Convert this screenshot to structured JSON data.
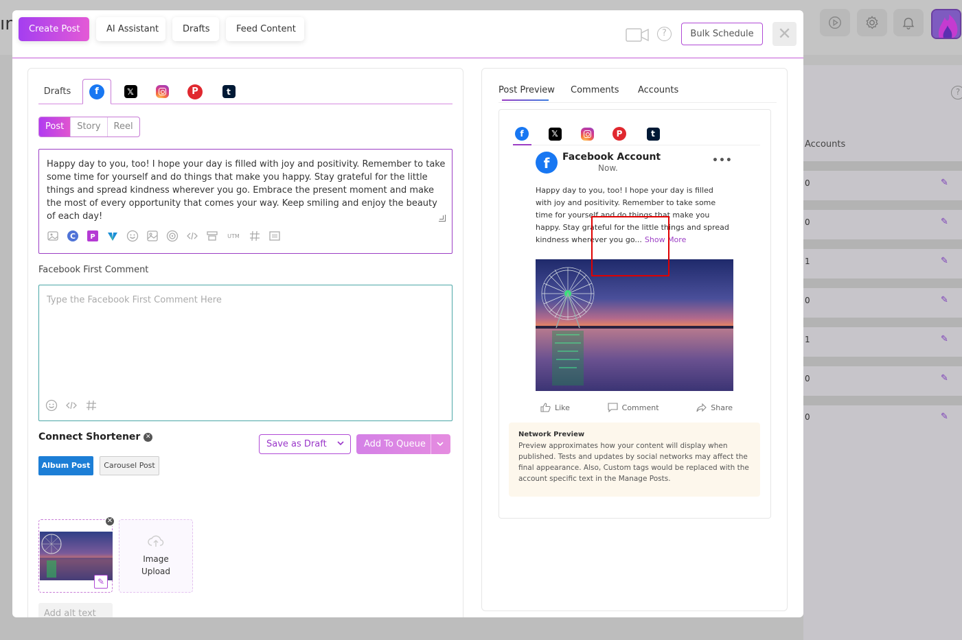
{
  "background": {
    "left_text": "ın",
    "accounts_header": "Accounts",
    "rows": [
      "0",
      "0",
      "1",
      "0",
      "1",
      "0",
      "0"
    ]
  },
  "top_tabs": [
    {
      "label": "Create Post",
      "active": true
    },
    {
      "label": "AI Assistant"
    },
    {
      "label": "Drafts"
    },
    {
      "label": "Feed Content"
    }
  ],
  "header": {
    "help": "?",
    "bulk_schedule": "Bulk Schedule",
    "close": "✕"
  },
  "left": {
    "network_tabs": {
      "drafts_label": "Drafts",
      "networks": [
        "facebook",
        "x",
        "instagram",
        "pinterest",
        "tumblr"
      ],
      "active": "facebook"
    },
    "post_types": [
      {
        "label": "Post",
        "active": true
      },
      {
        "label": "Story"
      },
      {
        "label": "Reel"
      }
    ],
    "editor_text": "Happy day to you, too! I hope your day is filled with joy and positivity. Remember to take some time for yourself and do things that make you happy. Stay grateful for the little things and spread kindness wherever you go. Embrace the present moment and make the most of every opportunity that comes your way. Keep smiling and enjoy the beauty of each day!",
    "toolbar_icons": [
      "ai-image-icon",
      "canva-icon",
      "picsart-icon",
      "vista-icon",
      "emoji-icon",
      "gallery-icon",
      "target-icon",
      "code-icon",
      "template-icon",
      "utm-icon",
      "hashtag-icon",
      "media-icon"
    ],
    "utm_label": "UTM",
    "first_comment_label": "Facebook First Comment",
    "first_comment_placeholder": "Type the Facebook First Comment Here",
    "shortener_label": "Connect Shortener",
    "save_draft": "Save as Draft",
    "add_to_queue": "Add To Queue",
    "album_post": "Album Post",
    "carousel_post": "Carousel Post",
    "upload_label_1": "Image",
    "upload_label_2": "Upload",
    "alt_text_placeholder": "Add alt text to"
  },
  "right": {
    "tabs": [
      "Post Preview",
      "Comments",
      "Accounts"
    ],
    "active_tab": "Post Preview",
    "preview_networks": [
      "facebook",
      "x",
      "instagram",
      "pinterest",
      "tumblr"
    ],
    "account_name": "Facebook Account",
    "time": "Now.",
    "preview_text": "Happy day to you, too! I hope your day is filled with joy and positivity. Remember to take some time for yourself and do things that make you happy. Stay grateful for the little things and spread kindness wherever you go...",
    "show_more": "Show More",
    "actions": {
      "like": "Like",
      "comment": "Comment",
      "share": "Share"
    },
    "network_preview_title": "Network Preview",
    "network_preview_text": "Preview approximates how your content will display when published. Tests and updates by social networks may affect the final appearance. Also, Custom tags would be replaced with the account specific text in the Manage Posts."
  },
  "colors": {
    "accent": "#b13bf0",
    "facebook": "#1877f2",
    "pinterest": "#e0282f",
    "album_blue": "#1c7ed6",
    "highlight": "#e00000"
  }
}
